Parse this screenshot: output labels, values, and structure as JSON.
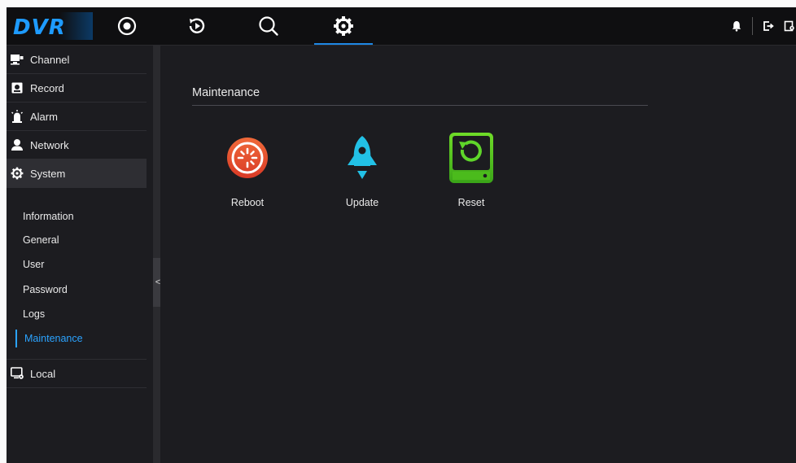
{
  "logo": {
    "text": "DVR"
  },
  "topnav": {
    "items": [
      {
        "icon": "live-view-icon"
      },
      {
        "icon": "playback-icon"
      },
      {
        "icon": "search-icon"
      },
      {
        "icon": "settings-gear-icon",
        "active": true
      }
    ],
    "right_icons": [
      "bell-icon",
      "logout-icon",
      "lock-icon"
    ]
  },
  "sidebar": {
    "items": [
      {
        "label": "Channel",
        "icon": "channel-icon"
      },
      {
        "label": "Record",
        "icon": "record-icon"
      },
      {
        "label": "Alarm",
        "icon": "alarm-icon"
      },
      {
        "label": "Network",
        "icon": "network-icon"
      },
      {
        "label": "System",
        "icon": "system-gear-icon",
        "active": true
      },
      {
        "label": "Local",
        "icon": "local-monitor-icon"
      }
    ],
    "system_subitems": [
      {
        "label": "Information"
      },
      {
        "label": "General"
      },
      {
        "label": "User"
      },
      {
        "label": "Password"
      },
      {
        "label": "Logs"
      },
      {
        "label": "Maintenance",
        "active": true
      }
    ],
    "collapse_glyph": "<"
  },
  "main": {
    "title": "Maintenance",
    "tiles": [
      {
        "label": "Reboot",
        "icon": "reboot-icon",
        "color": "#e84b2f"
      },
      {
        "label": "Update",
        "icon": "rocket-update-icon",
        "color": "#22c1e6"
      },
      {
        "label": "Reset",
        "icon": "reset-icon",
        "color": "#49b91e"
      }
    ]
  },
  "colors": {
    "accent": "#1e88e5",
    "active_text": "#2ba3ff",
    "background": "#1c1c20"
  }
}
